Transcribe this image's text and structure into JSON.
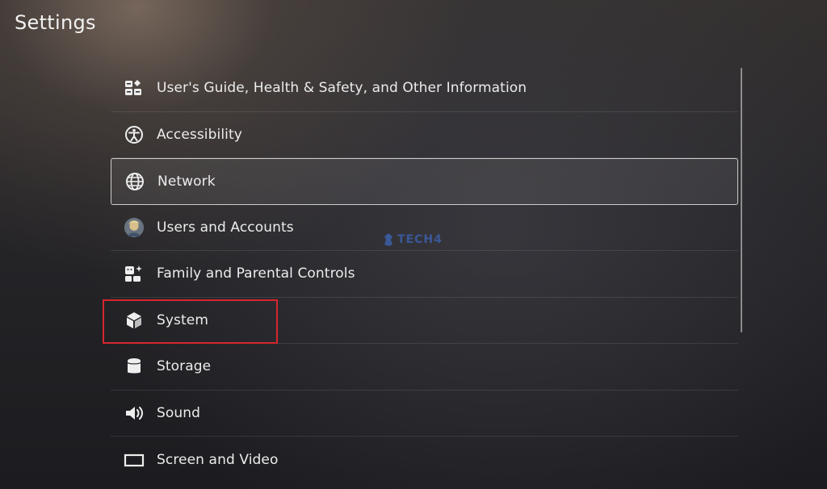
{
  "header": {
    "title": "Settings"
  },
  "menu": {
    "items": [
      {
        "label": "User's Guide, Health & Safety, and Other Information",
        "icon": "guide-icon"
      },
      {
        "label": "Accessibility",
        "icon": "accessibility-icon"
      },
      {
        "label": "Network",
        "icon": "globe-icon",
        "focused": true
      },
      {
        "label": "Users and Accounts",
        "icon": "user-avatar-icon"
      },
      {
        "label": "Family and Parental Controls",
        "icon": "family-icon"
      },
      {
        "label": "System",
        "icon": "system-cube-icon",
        "highlighted": true
      },
      {
        "label": "Storage",
        "icon": "storage-cylinder-icon"
      },
      {
        "label": "Sound",
        "icon": "speaker-icon"
      },
      {
        "label": "Screen and Video",
        "icon": "screen-icon"
      }
    ]
  },
  "watermark": {
    "text": "TECH4"
  },
  "colors": {
    "highlight": "#d7262e",
    "focus_border": "#e6e6e6",
    "watermark": "#3d5fa8"
  }
}
